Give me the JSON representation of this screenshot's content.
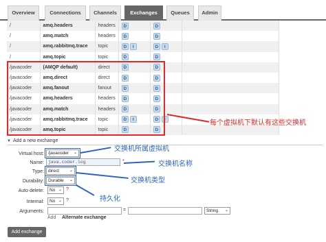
{
  "tabs": [
    "Overview",
    "Connections",
    "Channels",
    "Exchanges",
    "Queues",
    "Admin"
  ],
  "active_tab": "Exchanges",
  "exchanges": [
    {
      "vhost": "/",
      "name": "amq.headers",
      "type": "headers",
      "features": [
        "D"
      ]
    },
    {
      "vhost": "/",
      "name": "amq.match",
      "type": "headers",
      "features": [
        "D"
      ]
    },
    {
      "vhost": "/",
      "name": "amq.rabbitmq.trace",
      "type": "topic",
      "features": [
        "D",
        "I"
      ]
    },
    {
      "vhost": "/",
      "name": "amq.topic",
      "type": "topic",
      "features": [
        "D"
      ]
    },
    {
      "vhost": "/javacoder",
      "name": "(AMQP default)",
      "type": "direct",
      "features": [
        "D"
      ]
    },
    {
      "vhost": "/javacoder",
      "name": "amq.direct",
      "type": "direct",
      "features": [
        "D"
      ]
    },
    {
      "vhost": "/javacoder",
      "name": "amq.fanout",
      "type": "fanout",
      "features": [
        "D"
      ]
    },
    {
      "vhost": "/javacoder",
      "name": "amq.headers",
      "type": "headers",
      "features": [
        "D"
      ]
    },
    {
      "vhost": "/javacoder",
      "name": "amq.match",
      "type": "headers",
      "features": [
        "D"
      ]
    },
    {
      "vhost": "/javacoder",
      "name": "amq.rabbitmq.trace",
      "type": "topic",
      "features": [
        "D",
        "I"
      ]
    },
    {
      "vhost": "/javacoder",
      "name": "amq.topic",
      "type": "topic",
      "features": [
        "D"
      ]
    }
  ],
  "add_section": {
    "title": "Add a new exchange",
    "virtual_host_label": "Virtual host:",
    "virtual_host_value": "/javacoder",
    "name_label": "Name:",
    "name_value": "java.coder.log",
    "type_label": "Type:",
    "type_value": "direct",
    "durability_label": "Durability:",
    "durability_value": "Durable",
    "auto_delete_label": "Auto delete:",
    "auto_delete_value": "No",
    "internal_label": "Internal:",
    "internal_value": "No",
    "arguments_label": "Arguments:",
    "arguments_equals": "=",
    "arguments_type": "String",
    "add_link": "Add",
    "alternate_exchange": "Alternate exchange",
    "submit_label": "Add exchange"
  },
  "annotations": {
    "vhost_note": "每个虚拟机下默认有这些交换机",
    "virtual_host_note": "交换机所属虚拟机",
    "name_note": "交换机名称",
    "type_note": "交换机类型",
    "durability_note": "持久化"
  },
  "colors": {
    "annotation_red": "#e32626",
    "annotation_blue": "#2c63c4",
    "badge_bg": "#c8dcf0",
    "tab_active": "#666666"
  }
}
